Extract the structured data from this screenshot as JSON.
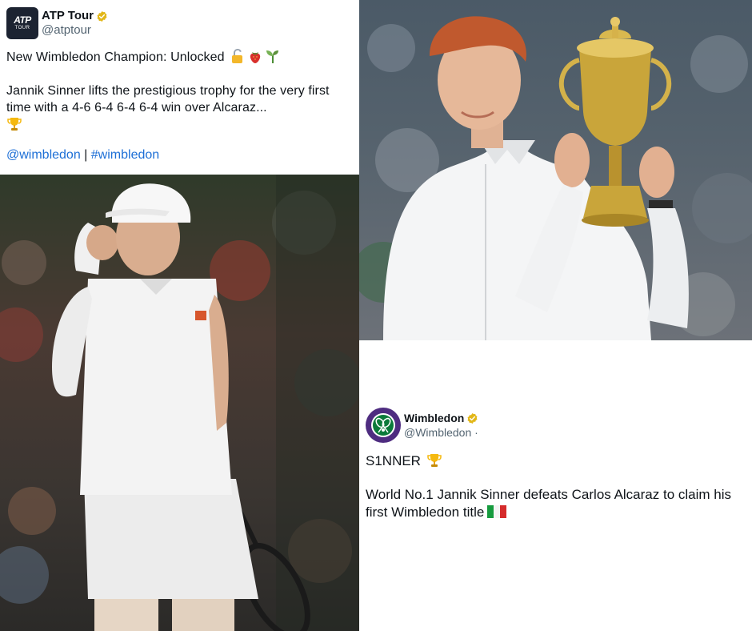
{
  "atp_tweet": {
    "display_name": "ATP Tour",
    "handle": "@atptour",
    "avatar_line1": "ATP",
    "avatar_line2": "TOUR",
    "line1": "New Wimbledon Champion: Unlocked",
    "line1_emojis": [
      "unlocked-padlock-icon",
      "strawberry-icon",
      "seedling-icon"
    ],
    "body": "Jannik Sinner lifts the prestigious trophy for the very first time with a 4-6 6-4 6-4 6-4 win over Alcaraz...",
    "body_emoji": "trophy-icon",
    "link1": "@wimbledon",
    "separator": " | ",
    "link2": "#wimbledon"
  },
  "wimbledon_tweet": {
    "display_name": "Wimbledon",
    "handle": "@Wimbledon ·",
    "line1": "S1NNER",
    "line1_emoji": "trophy-icon",
    "body": "World No.1 Jannik Sinner defeats Carlos Alcaraz to claim his first Wimbledon title",
    "body_emoji": "italy-flag-icon"
  },
  "colors": {
    "verified_gold": "#e2b719",
    "link_blue": "#1d6fd6",
    "handle_gray": "#536471",
    "wimbledon_purple": "#4e2c80",
    "wimbledon_green": "#0b7a3a"
  }
}
